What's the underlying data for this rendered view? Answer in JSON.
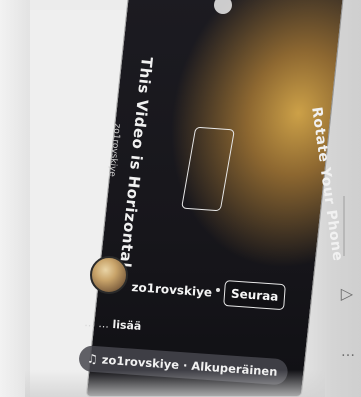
{
  "video": {
    "title_text": "This Video is Horizontal",
    "subtitle_text": "zo1rovskiye",
    "rotate_text": "Rotate Your Phone"
  },
  "author": {
    "username": "zo1rovskiye",
    "separator": "•",
    "follow_label": "Seuraa"
  },
  "description": {
    "ellipsis": "... ...",
    "more_label": "lisää"
  },
  "audio": {
    "icon": "music-note-icon",
    "label": "zo1rovskiye · Alkuperäinen"
  },
  "colors": {
    "panel_dark": "#17161b",
    "panel_glow": "#d6a84a",
    "text_light": "#f1f1f1"
  }
}
